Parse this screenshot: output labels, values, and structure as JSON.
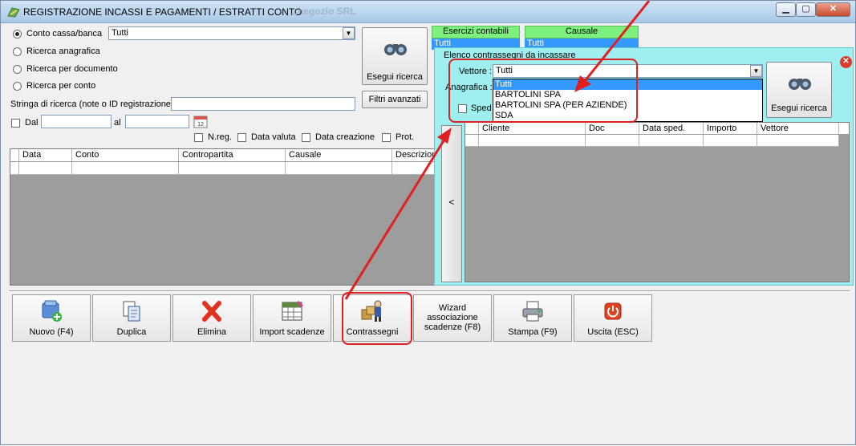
{
  "window": {
    "title": "REGISTRAZIONE INCASSI E PAGAMENTI / ESTRATTI CONTO",
    "ghost_title": "...negozio SRL",
    "min": "0",
    "max": "1",
    "close": "r"
  },
  "search": {
    "options": [
      "Conto cassa/banca",
      "Ricerca anagrafica",
      "Ricerca per documento",
      "Ricerca per conto"
    ],
    "conto_value": "Tutti",
    "search_button": "Esegui ricerca",
    "advanced_button": "Filtri avanzati",
    "string_label": "Stringa di ricerca (note o ID registrazione)",
    "dal_label": "Dal",
    "al_label": "al",
    "flags": [
      "N.reg.",
      "Data valuta",
      "Data creazione",
      "Prot."
    ]
  },
  "esercizi": {
    "label": "Esercizi contabili",
    "value": "Tutti"
  },
  "causale": {
    "label": "Causale",
    "value": "Tutti"
  },
  "main_grid": {
    "columns": [
      "Data",
      "Conto",
      "Contropartita",
      "Causale",
      "Descrizion"
    ]
  },
  "popup": {
    "title": "Elenco contrassegni da incassare",
    "vettore_label": "Vettore :",
    "vettore_value": "Tutti",
    "vettore_options": [
      "Tutti",
      "BARTOLINI SPA",
      "BARTOLINI SPA (PER AZIENDE)",
      "SDA"
    ],
    "anagrafica_label": "Anagrafica :",
    "sped_label": "Sped",
    "search_button": "Esegui ricerca",
    "collapse": "<",
    "columns": [
      "Cliente",
      "Doc",
      "Data sped.",
      "Importo",
      "Vettore"
    ]
  },
  "toolbar": [
    {
      "label": "Nuovo (F4)",
      "icon": "new-record-icon"
    },
    {
      "label": "Duplica",
      "icon": "duplicate-icon"
    },
    {
      "label": "Elimina",
      "icon": "delete-icon"
    },
    {
      "label": "Import scadenze",
      "icon": "spreadsheet-icon"
    },
    {
      "label": "Contrassegni",
      "icon": "courier-icon"
    },
    {
      "label": "Wizard associazione scadenze (F8)",
      "icon": ""
    },
    {
      "label": "Stampa (F9)",
      "icon": "printer-icon"
    },
    {
      "label": "Uscita (ESC)",
      "icon": "power-icon"
    }
  ],
  "colors": {
    "accent_green": "#7ef07e",
    "popup_cyan": "#9feef0",
    "select_blue": "#3399ff",
    "annotation_red": "#e02020"
  }
}
